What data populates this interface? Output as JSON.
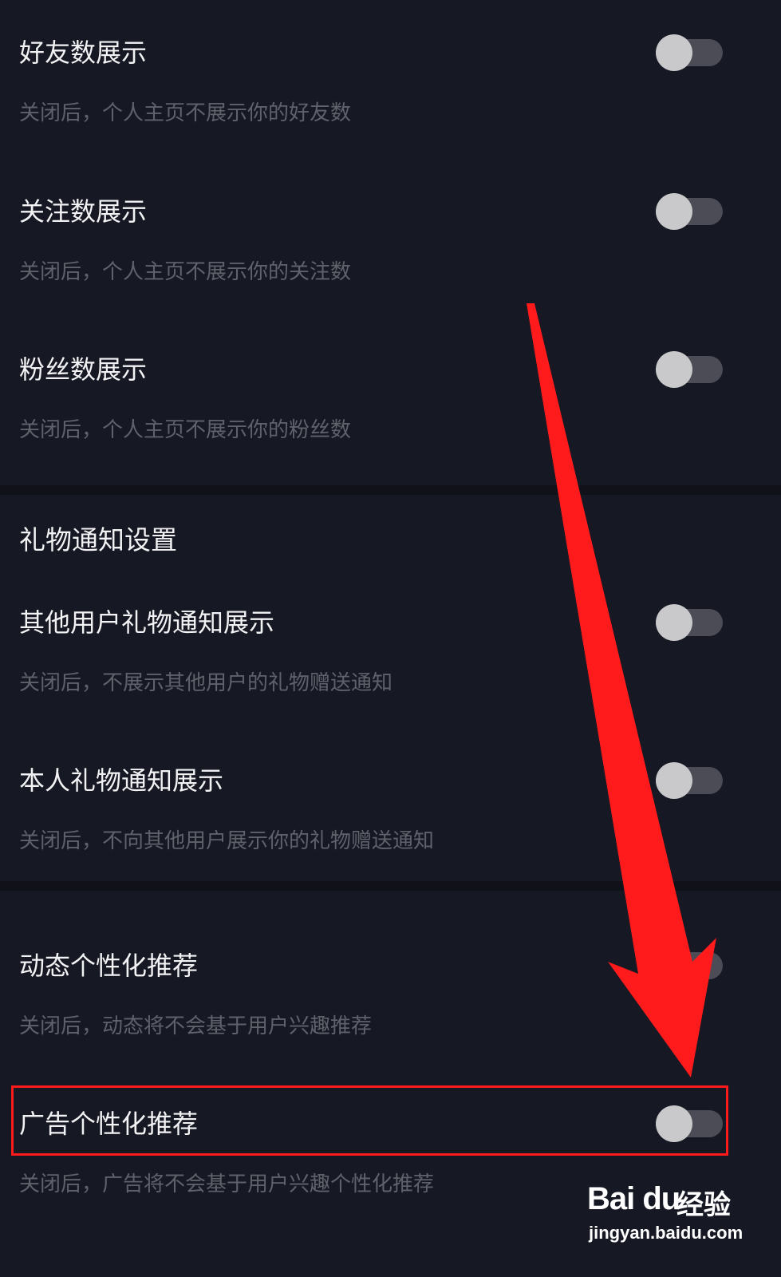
{
  "settings": [
    {
      "title": "好友数展示",
      "desc": "关闭后，个人主页不展示你的好友数",
      "on": false
    },
    {
      "title": "关注数展示",
      "desc": "关闭后，个人主页不展示你的关注数",
      "on": false
    },
    {
      "title": "粉丝数展示",
      "desc": "关闭后，个人主页不展示你的粉丝数",
      "on": false
    }
  ],
  "gift_section": {
    "title": "礼物通知设置",
    "items": [
      {
        "title": "其他用户礼物通知展示",
        "desc": "关闭后，不展示其他用户的礼物赠送通知",
        "on": false
      },
      {
        "title": "本人礼物通知展示",
        "desc": "关闭后，不向其他用户展示你的礼物赠送通知",
        "on": false
      }
    ]
  },
  "personalization": [
    {
      "title": "动态个性化推荐",
      "desc": "关闭后，动态将不会基于用户兴趣推荐",
      "on": false
    },
    {
      "title": "广告个性化推荐",
      "desc": "关闭后，广告将不会基于用户兴趣个性化推荐",
      "on": false
    }
  ],
  "watermark": {
    "brand": "Bai du",
    "suffix": "经验",
    "url": "jingyan.baidu.com"
  },
  "colors": {
    "background": "#161823",
    "annotation": "#ff1b1b",
    "toggle_track": "#4b4c55",
    "toggle_knob": "#c9c9cb"
  }
}
